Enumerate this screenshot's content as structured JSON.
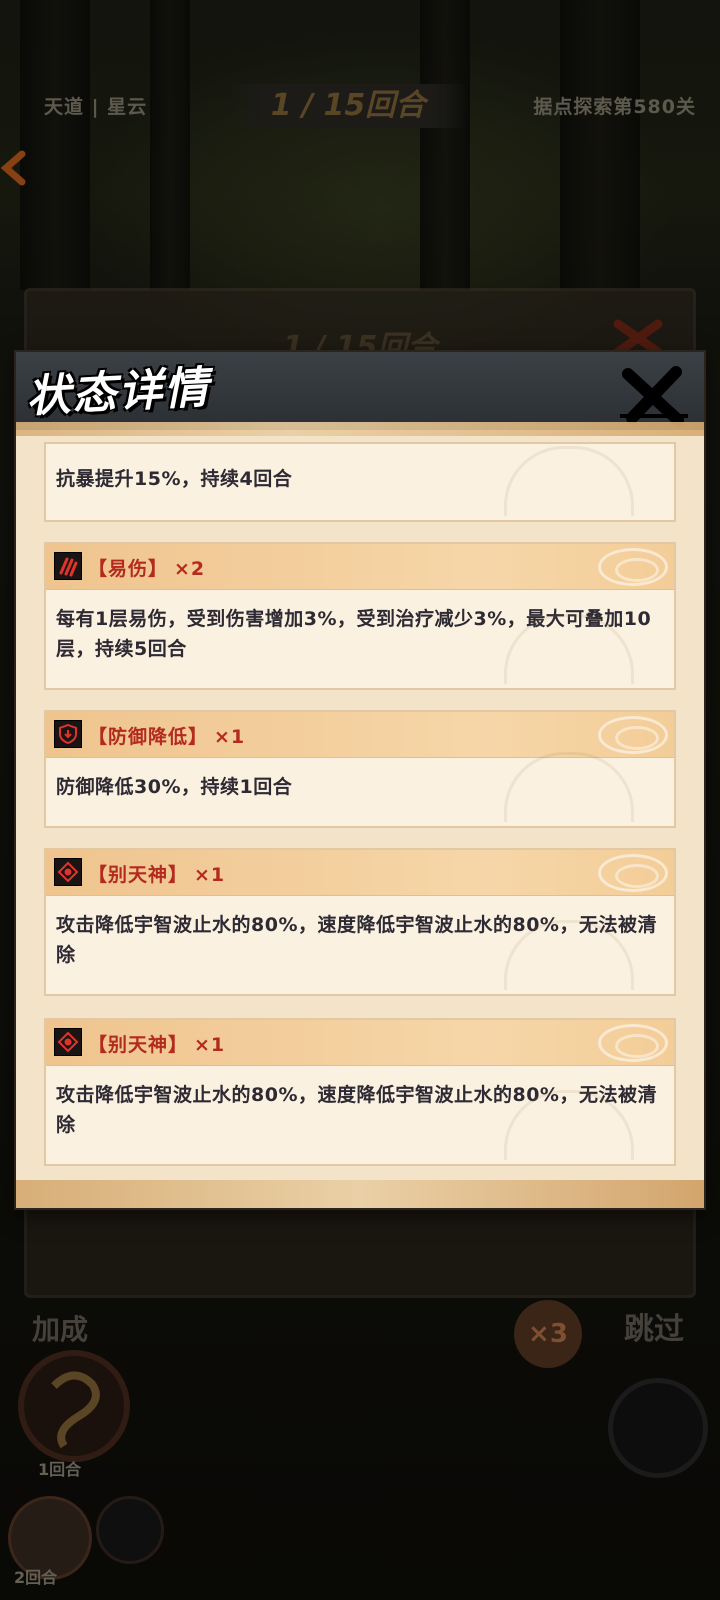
{
  "top_hud": {
    "left_text": "天道 | 星云",
    "round": "1 / 15回合",
    "right_text": "据点探索第580关"
  },
  "battle_panel": {
    "round": "1 / 15回合"
  },
  "bottom_hud": {
    "left_label": "加成",
    "skip_label": "跳过",
    "speed_label": "×3",
    "skill_round": "1回合",
    "avatar_round": "2回合"
  },
  "dialog": {
    "title": "状态详情",
    "cards": [
      {
        "name": "",
        "count": "",
        "icon": "none",
        "desc": "抗暴提升15%，持续4回合"
      },
      {
        "name": "【易伤】",
        "count": "×2",
        "icon": "claw-icon",
        "desc": "每有1层易伤，受到伤害增加3%，受到治疗减少3%，最大可叠加10层，持续5回合"
      },
      {
        "name": "【防御降低】",
        "count": "×1",
        "icon": "shield-down-icon",
        "desc": "防御降低30%，持续1回合"
      },
      {
        "name": "【别天神】",
        "count": "×1",
        "icon": "eye-icon",
        "desc": "攻击降低宇智波止水的80%，速度降低宇智波止水的80%，无法被清除"
      },
      {
        "name": "【别天神】",
        "count": "×1",
        "icon": "eye-icon",
        "desc": "攻击降低宇智波止水的80%，速度降低宇智波止水的80%，无法被清除"
      }
    ]
  },
  "colors": {
    "card_title": "#b32b1f",
    "card_text": "#2e2a34",
    "header_bg": "#2b2f33",
    "card_head": "#efc48e"
  }
}
